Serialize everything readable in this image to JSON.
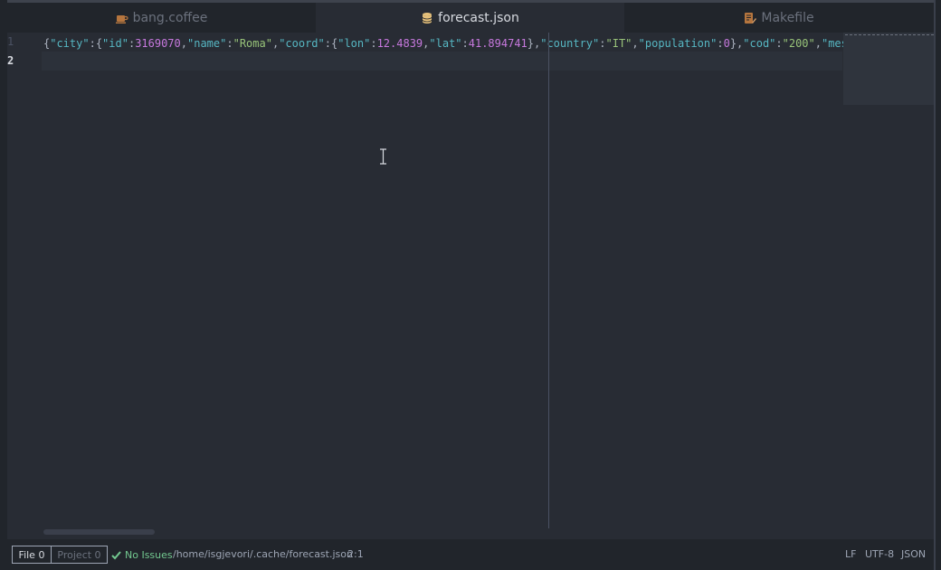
{
  "colors": {
    "background": "#282c34",
    "tab_bar": "#21252b",
    "status_bar": "#21252b",
    "line_highlight": "#2c313a",
    "json_key": "#56b6c2",
    "json_number": "#c678dd",
    "json_string": "#98c379",
    "no_issues_green": "#73c990",
    "coffee_icon": "#b5753e",
    "json_icon": "#e5c07b"
  },
  "tabs": [
    {
      "label": "bang.coffee",
      "icon": "coffee-icon",
      "active": false
    },
    {
      "label": "forecast.json",
      "icon": "database-icon",
      "active": true
    },
    {
      "label": "Makefile",
      "icon": "makefile-icon",
      "active": false
    }
  ],
  "editor": {
    "line_numbers": [
      "1",
      "2"
    ],
    "current_line": 2,
    "line1_tokens": [
      {
        "text": "{",
        "type": "punct"
      },
      {
        "text": "\"city\"",
        "type": "key"
      },
      {
        "text": ":{",
        "type": "punct"
      },
      {
        "text": "\"id\"",
        "type": "key"
      },
      {
        "text": ":",
        "type": "punct"
      },
      {
        "text": "3169070",
        "type": "num"
      },
      {
        "text": ",",
        "type": "punct"
      },
      {
        "text": "\"name\"",
        "type": "key"
      },
      {
        "text": ":",
        "type": "punct"
      },
      {
        "text": "\"Roma\"",
        "type": "str"
      },
      {
        "text": ",",
        "type": "punct"
      },
      {
        "text": "\"coord\"",
        "type": "key"
      },
      {
        "text": ":{",
        "type": "punct"
      },
      {
        "text": "\"lon\"",
        "type": "key"
      },
      {
        "text": ":",
        "type": "punct"
      },
      {
        "text": "12.4839",
        "type": "num"
      },
      {
        "text": ",",
        "type": "punct"
      },
      {
        "text": "\"lat\"",
        "type": "key"
      },
      {
        "text": ":",
        "type": "punct"
      },
      {
        "text": "41.894741",
        "type": "num"
      },
      {
        "text": "},",
        "type": "punct"
      },
      {
        "text": "\"country\"",
        "type": "key"
      },
      {
        "text": ":",
        "type": "punct"
      },
      {
        "text": "\"IT\"",
        "type": "str"
      },
      {
        "text": ",",
        "type": "punct"
      },
      {
        "text": "\"population\"",
        "type": "key"
      },
      {
        "text": ":",
        "type": "punct"
      },
      {
        "text": "0",
        "type": "num"
      },
      {
        "text": "},",
        "type": "punct"
      },
      {
        "text": "\"cod\"",
        "type": "key"
      },
      {
        "text": ":",
        "type": "punct"
      },
      {
        "text": "\"200\"",
        "type": "str"
      },
      {
        "text": ",",
        "type": "punct"
      },
      {
        "text": "\"message",
        "type": "key"
      }
    ]
  },
  "status": {
    "file_counter": "File 0",
    "project_counter": "Project 0",
    "issues": "No Issues",
    "path": "/home/isgjevori/.cache/forecast.json",
    "cursor": "2:1",
    "line_ending": "LF",
    "encoding": "UTF-8",
    "grammar": "JSON"
  }
}
